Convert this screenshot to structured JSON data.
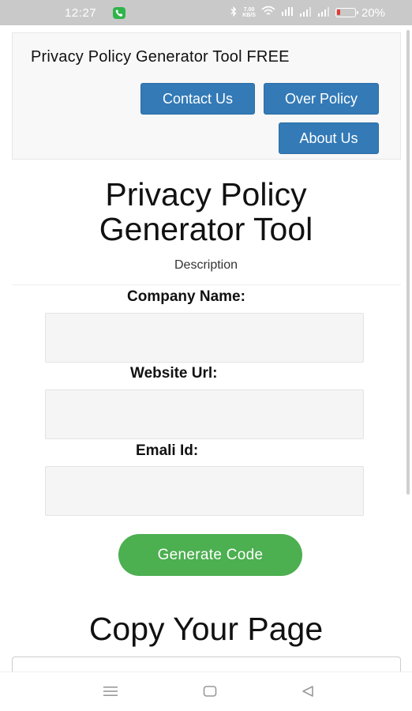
{
  "status_bar": {
    "time": "12:27",
    "net_speed_top": "7.00",
    "net_speed_bottom": "KB/S",
    "battery_percent": "20%",
    "battery_level": 0.2,
    "battery_color": "#e53935",
    "icons": [
      "phone-call-icon",
      "bluetooth-icon",
      "wifi-icon",
      "volte-icon",
      "signal-icon",
      "signal-icon",
      "battery-icon"
    ]
  },
  "header": {
    "brand": "Privacy Policy Generator Tool FREE",
    "nav": {
      "contact": "Contact Us",
      "over_policy": "Over Policy",
      "about": "About Us"
    },
    "nav_color": "#337ab7"
  },
  "main": {
    "title_line1": "Privacy Policy",
    "title_line2": "Generator Tool",
    "description": "Description"
  },
  "form": {
    "company_label": "Company Name:",
    "company_value": "",
    "website_label": "Website Url:",
    "website_value": "",
    "email_label": "Emali Id:",
    "email_value": "",
    "generate_label": "Generate Code",
    "generate_color": "#4caf50"
  },
  "output": {
    "title": "Copy Your Page"
  },
  "system_nav": {
    "icons": [
      "menu-icon",
      "home-icon",
      "back-icon"
    ]
  }
}
